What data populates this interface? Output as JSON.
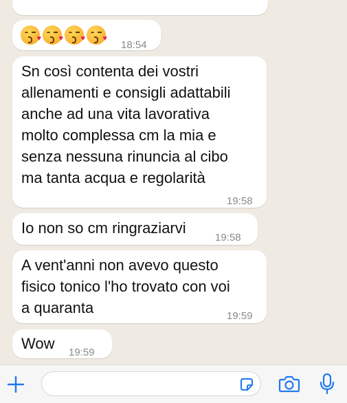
{
  "messages": [
    {
      "text": "",
      "time": ""
    },
    {
      "emojis": [
        "kissing-face-with-heart-icon",
        "kissing-face-with-heart-icon",
        "kissing-face-with-heart-icon",
        "kissing-face-with-heart-icon"
      ],
      "time": "18:54"
    },
    {
      "text": "Sn così contenta dei vostri\nallenamenti e consigli adattabili\nanche ad una vita lavorativa\nmolto complessa cm la mia e\nsenza nessuna rinuncia al cibo\nma tanta acqua e regolarità",
      "time": "19:58"
    },
    {
      "text": "Io non so cm ringraziarvi",
      "time": "19:58"
    },
    {
      "text": "A vent'anni non avevo questo\nfisico tonico l'ho trovato con voi\na quaranta",
      "time": "19:59"
    },
    {
      "text": "Wow",
      "time": "19:59"
    }
  ],
  "composer": {
    "placeholder": "",
    "icons": [
      "plus-icon",
      "sticker-icon",
      "camera-icon",
      "microphone-icon"
    ]
  },
  "colors": {
    "background": "#efeae2",
    "bubble": "#ffffff",
    "accent": "#1f7aec",
    "timestamp": "#8a8a8a"
  }
}
